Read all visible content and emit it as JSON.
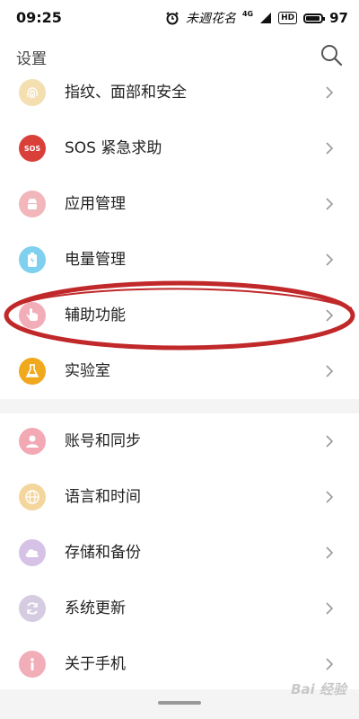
{
  "status_bar": {
    "time": "09:25",
    "carrier": "未週花名",
    "network": "4G",
    "hd": "HD",
    "battery": "97"
  },
  "header": {
    "title": "设置",
    "search_icon": "search-icon"
  },
  "group1": [
    {
      "label": "指纹、面部和安全",
      "icon": "fingerprint-icon",
      "color": "#f3dfb0"
    },
    {
      "label": "SOS 紧急求助",
      "icon": "sos-icon",
      "color": "#d9403a",
      "icon_text": "SOS"
    },
    {
      "label": "应用管理",
      "icon": "android-app-icon",
      "color": "#f2b7bb"
    },
    {
      "label": "电量管理",
      "icon": "battery-icon",
      "color": "#7fd0ef"
    },
    {
      "label": "辅助功能",
      "icon": "hand-pointer-icon",
      "color": "#f2aeb8"
    },
    {
      "label": "实验室",
      "icon": "flask-icon",
      "color": "#f0a81c"
    }
  ],
  "group2": [
    {
      "label": "账号和同步",
      "icon": "account-icon",
      "color": "#f2a9b4"
    },
    {
      "label": "语言和时间",
      "icon": "globe-icon",
      "color": "#f4d69c"
    },
    {
      "label": "存储和备份",
      "icon": "cloud-icon",
      "color": "#d6c2e6"
    },
    {
      "label": "系统更新",
      "icon": "refresh-icon",
      "color": "#d6cce2"
    },
    {
      "label": "关于手机",
      "icon": "info-icon",
      "color": "#f2aeb8"
    }
  ],
  "watermark": "Bai 经验",
  "colors": {
    "annotation": "#c0282a",
    "chevron": "#9a9a9a"
  }
}
